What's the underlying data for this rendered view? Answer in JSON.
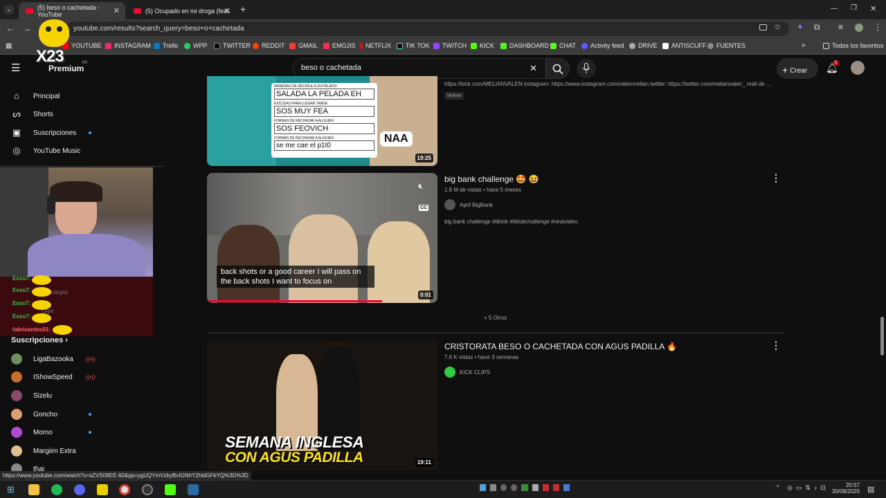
{
  "browser": {
    "tabs": [
      {
        "title": "(5) beso o cachetada - YouTube",
        "active": true
      },
      {
        "title": "(5) Ocupado en mi droga (feat.",
        "active": false
      }
    ],
    "new_tab": "+",
    "url": "youtube.com/results?search_query=beso+o+cachetada",
    "bookmarks": [
      "YOUTUBE",
      "INSTAGRAM",
      "Trello",
      "WPP",
      "TWITTER",
      "REDDIT",
      "GMAIL",
      "EMOJIS",
      "NETFLIX",
      "TIK TOK",
      "TWITCH",
      "KICK",
      "DASHBOARD",
      "CHAT",
      "Activity feed",
      "DRIVE",
      "ANTISCUFF",
      "FUENTES"
    ],
    "all_bookmarks": "Todos los favoritos",
    "status_url": "https://www.youtube.com/watch?v=sZVS09EE-60&pp=ygUQYmVzbyBvIGNhY2hldGFkYQ%3D%3D"
  },
  "youtube": {
    "logo": "Premium",
    "region": "AR",
    "search_value": "beso o cachetada",
    "create_label": "Crear",
    "notif_count": "5",
    "nav": [
      {
        "label": "Principal",
        "icon": "home-icon"
      },
      {
        "label": "Shorts",
        "icon": "shorts-icon"
      },
      {
        "label": "Suscripciones",
        "icon": "subscriptions-icon"
      },
      {
        "label": "YouTube Music",
        "icon": "music-icon"
      }
    ],
    "subs_heading": "Suscripciones",
    "subscriptions": [
      {
        "name": "LigaBazooka",
        "state": "live",
        "color": "#6b8f5e"
      },
      {
        "name": "IShowSpeed",
        "state": "live",
        "color": "#c8702a"
      },
      {
        "name": "Sizelu",
        "state": "none",
        "color": "#8a4a6a"
      },
      {
        "name": "Goncho",
        "state": "dot",
        "color": "#d9a070"
      },
      {
        "name": "Momo",
        "state": "dot",
        "color": "#b04ad0"
      },
      {
        "name": "Margiim Extra",
        "state": "none",
        "color": "#e0c090"
      },
      {
        "name": "thai",
        "state": "none",
        "color": "#888888"
      }
    ],
    "results": [
      {
        "desc": "https://kick.com/MELIANVALEN instagram: https://www.instagram.com/valenmelian twitter: https://twitter.com/melianvalen_ mail de ...",
        "badge": "Nuevo",
        "duration": "19:25",
        "thumb_lines": [
          "MANERAS DE DECIRLE A UN PELADO",
          "SALADA LA PELADA EH",
          "EXCUSAS PARA LLEGAR TARDE",
          "SOS MUY FEA",
          "FORMAS DE RECHAZAR A ALGUIEN",
          "SOS FEOVICH",
          "FORMAS DE RECHAZAR A ALGUIEN",
          "se me cae el p1t0"
        ],
        "thumb_badge": "NAA"
      },
      {
        "title": "big bank challenge 🤩 😆",
        "meta": "1.9 M de vistas • hace 5 meses",
        "channel": "April BigBank",
        "desc": "big bank challenge #tiktok #tiktokchallenge #viralvideo.",
        "duration": "0:01",
        "caption": "back shots or a good career I will pass on the back shots I want to focus on",
        "cc": "CC"
      },
      {
        "more_label": "+ 5 Otros"
      },
      {
        "title": "CRISTORATA BESO O CACHETADA CON AGUS PADILLA 🔥",
        "meta": "7.6 K vistas • hace 3 semanas",
        "channel": "KICK CLIPS",
        "duration": "19:11",
        "thumb_text": [
          "SEMANA INGLESA",
          "CON AGUS PADILLA"
        ]
      }
    ]
  },
  "overlay": {
    "logo_text": "X23",
    "chat": [
      {
        "user": "Exxo7:",
        "color": "#2ecc40"
      },
      {
        "user": "Exxo7:",
        "color": "#2ecc40"
      },
      {
        "user": "Exxo7:",
        "color": "#2ecc40"
      },
      {
        "user": "Exxo7:",
        "color": "#2ecc40"
      },
      {
        "user": "fabrisantos01:",
        "color": "#ff6b6b"
      }
    ],
    "chat_bg_text": [
      "Descargas",
      "Clips"
    ]
  },
  "taskbar": {
    "time": "20:57",
    "date": "30/08/2025"
  }
}
